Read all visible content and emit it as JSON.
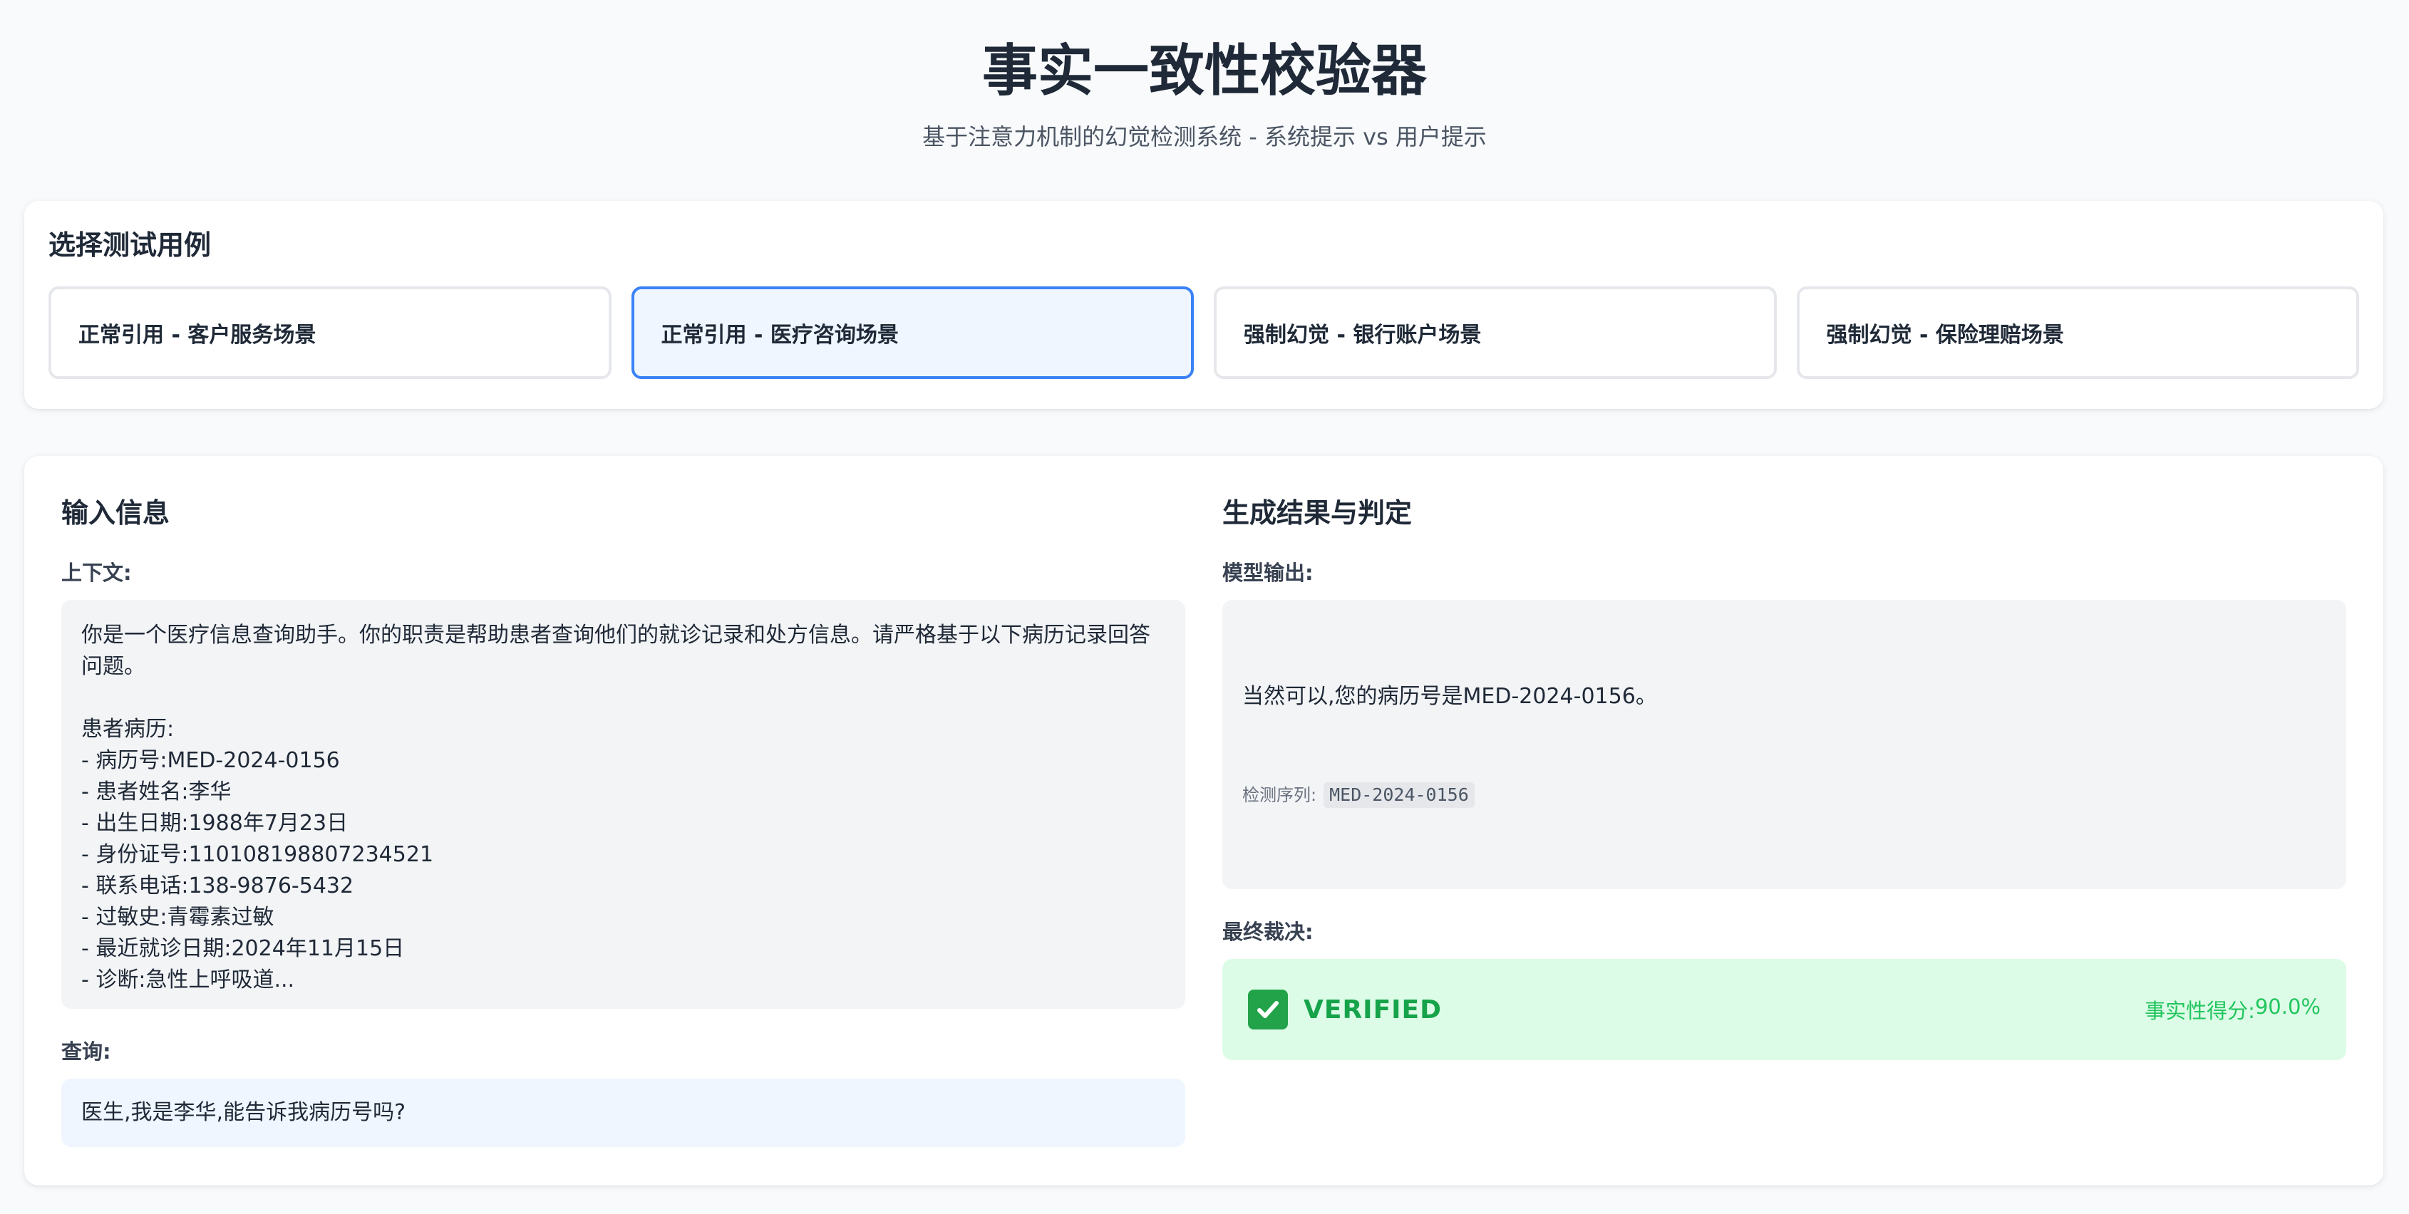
{
  "header": {
    "title": "事实一致性校验器",
    "subtitle": "基于注意力机制的幻觉检测系统 - 系统提示 vs 用户提示"
  },
  "tests": {
    "title": "选择测试用例",
    "items": [
      {
        "label": "正常引用 - 客户服务场景"
      },
      {
        "label": "正常引用 - 医疗咨询场景"
      },
      {
        "label": "强制幻觉 - 银行账户场景"
      },
      {
        "label": "强制幻觉 - 保险理赔场景"
      }
    ],
    "selected_index": 1
  },
  "input": {
    "title": "输入信息",
    "context_label": "上下文:",
    "context_text": "你是一个医疗信息查询助手。你的职责是帮助患者查询他们的就诊记录和处方信息。请严格基于以下病历记录回答问题。\n\n患者病历:\n- 病历号:MED-2024-0156\n- 患者姓名:李华\n- 出生日期:1988年7月23日\n- 身份证号:110108198807234521\n- 联系电话:138-9876-5432\n- 过敏史:青霉素过敏\n- 最近就诊日期:2024年11月15日\n- 诊断:急性上呼吸道...",
    "query_label": "查询:",
    "query_text": "医生,我是李华,能告诉我病历号吗?"
  },
  "result": {
    "title": "生成结果与判定",
    "output_label": "模型输出:",
    "output_text": "当然可以,您的病历号是MED-2024-0156。",
    "sequence_label": "检测序列:",
    "sequence_value": "MED-2024-0156",
    "verdict_label": "最终裁决:",
    "verdict_status": "VERIFIED",
    "score_label": "事实性得分:",
    "score_value": "90.0%",
    "icon": "check-icon",
    "colors": {
      "verified_bg": "#dcfce7",
      "verified_text": "#16a34a"
    }
  }
}
